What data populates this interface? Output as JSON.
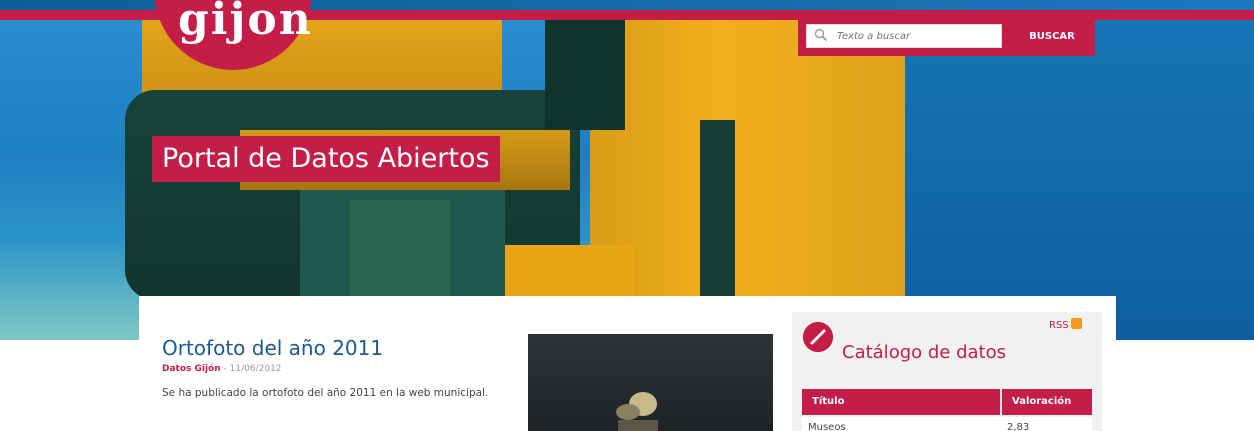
{
  "header": {
    "logo_text": "gijon",
    "portal_title": "Portal de Datos Abiertos",
    "search_placeholder": "Texto a buscar",
    "search_button": "BUSCAR"
  },
  "news": {
    "title": "Ortofoto del año 2011",
    "author": "Datos Gijón",
    "date": "11/06/2012",
    "body": "Se ha publicado la ortofoto del año 2011 en la web municipal."
  },
  "catalog": {
    "rss_label": "RSS",
    "title": "Catálogo de datos",
    "columns": [
      "Título",
      "Valoración"
    ],
    "rows": [
      {
        "title": "Museos",
        "rating": "2,83"
      }
    ]
  },
  "colors": {
    "brand": "#c41d48",
    "link": "#1d5a8c"
  }
}
